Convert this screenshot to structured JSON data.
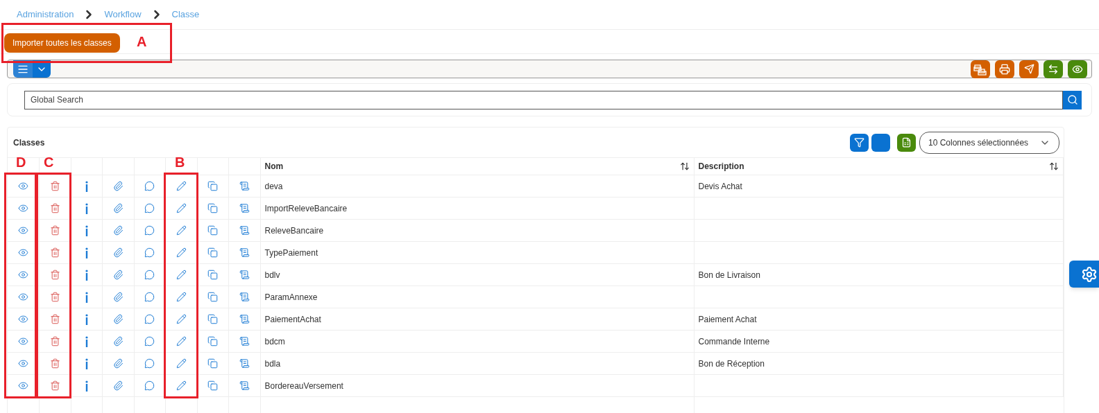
{
  "breadcrumb": [
    {
      "label": "Administration"
    },
    {
      "label": "Workflow"
    },
    {
      "label": "Classe"
    }
  ],
  "import_button": "Importer toutes les classes",
  "search": {
    "placeholder": "Global Search"
  },
  "table": {
    "title": "Classes",
    "columns_select": "10 Colonnes sélectionnées",
    "columns": [
      "Nom",
      "Description"
    ],
    "rows": [
      {
        "nom": "deva",
        "description": "Devis Achat"
      },
      {
        "nom": "ImportReleveBancaire",
        "description": ""
      },
      {
        "nom": "ReleveBancaire",
        "description": ""
      },
      {
        "nom": "TypePaiement",
        "description": ""
      },
      {
        "nom": "bdlv",
        "description": "Bon de Livraison"
      },
      {
        "nom": "ParamAnnexe",
        "description": ""
      },
      {
        "nom": "PaiementAchat",
        "description": "Paiement Achat"
      },
      {
        "nom": "bdcm",
        "description": "Commande Interne"
      },
      {
        "nom": "bdla",
        "description": "Bon de Réception"
      },
      {
        "nom": "BordereauVersement",
        "description": ""
      }
    ]
  },
  "annotations": [
    {
      "label": "A"
    },
    {
      "label": "D"
    },
    {
      "label": "C"
    },
    {
      "label": "B"
    }
  ]
}
